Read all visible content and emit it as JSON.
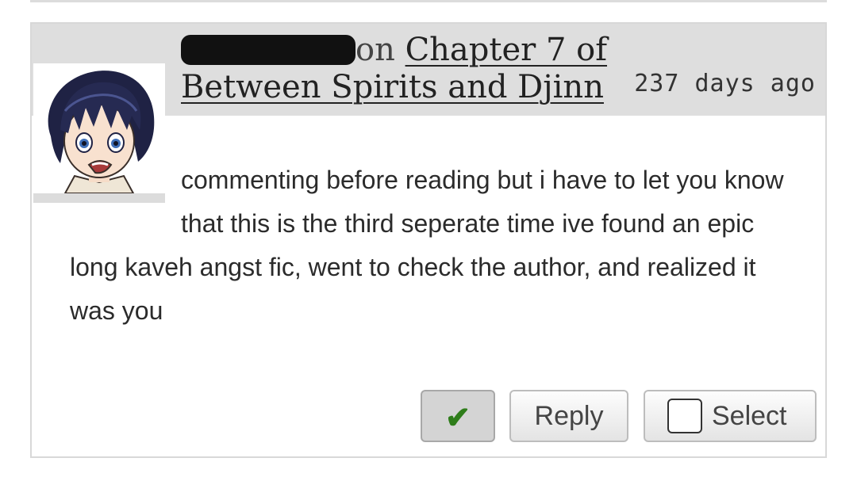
{
  "comment": {
    "on_word": "on",
    "work_title": "Chapter 7 of Between Spirits and Djinn",
    "timestamp": "237 days ago",
    "body": "commenting before reading but i have to let you know that this is the third seperate time ive found an epic long kaveh angst fic, went to check the author, and realized it was you"
  },
  "actions": {
    "check_icon": "check-mark-icon",
    "check_glyph": "✔",
    "reply_label": "Reply",
    "select_label": "Select"
  },
  "colors": {
    "header_bg": "#dedede",
    "check_green": "#2e7d1a",
    "redaction": "#111111"
  }
}
